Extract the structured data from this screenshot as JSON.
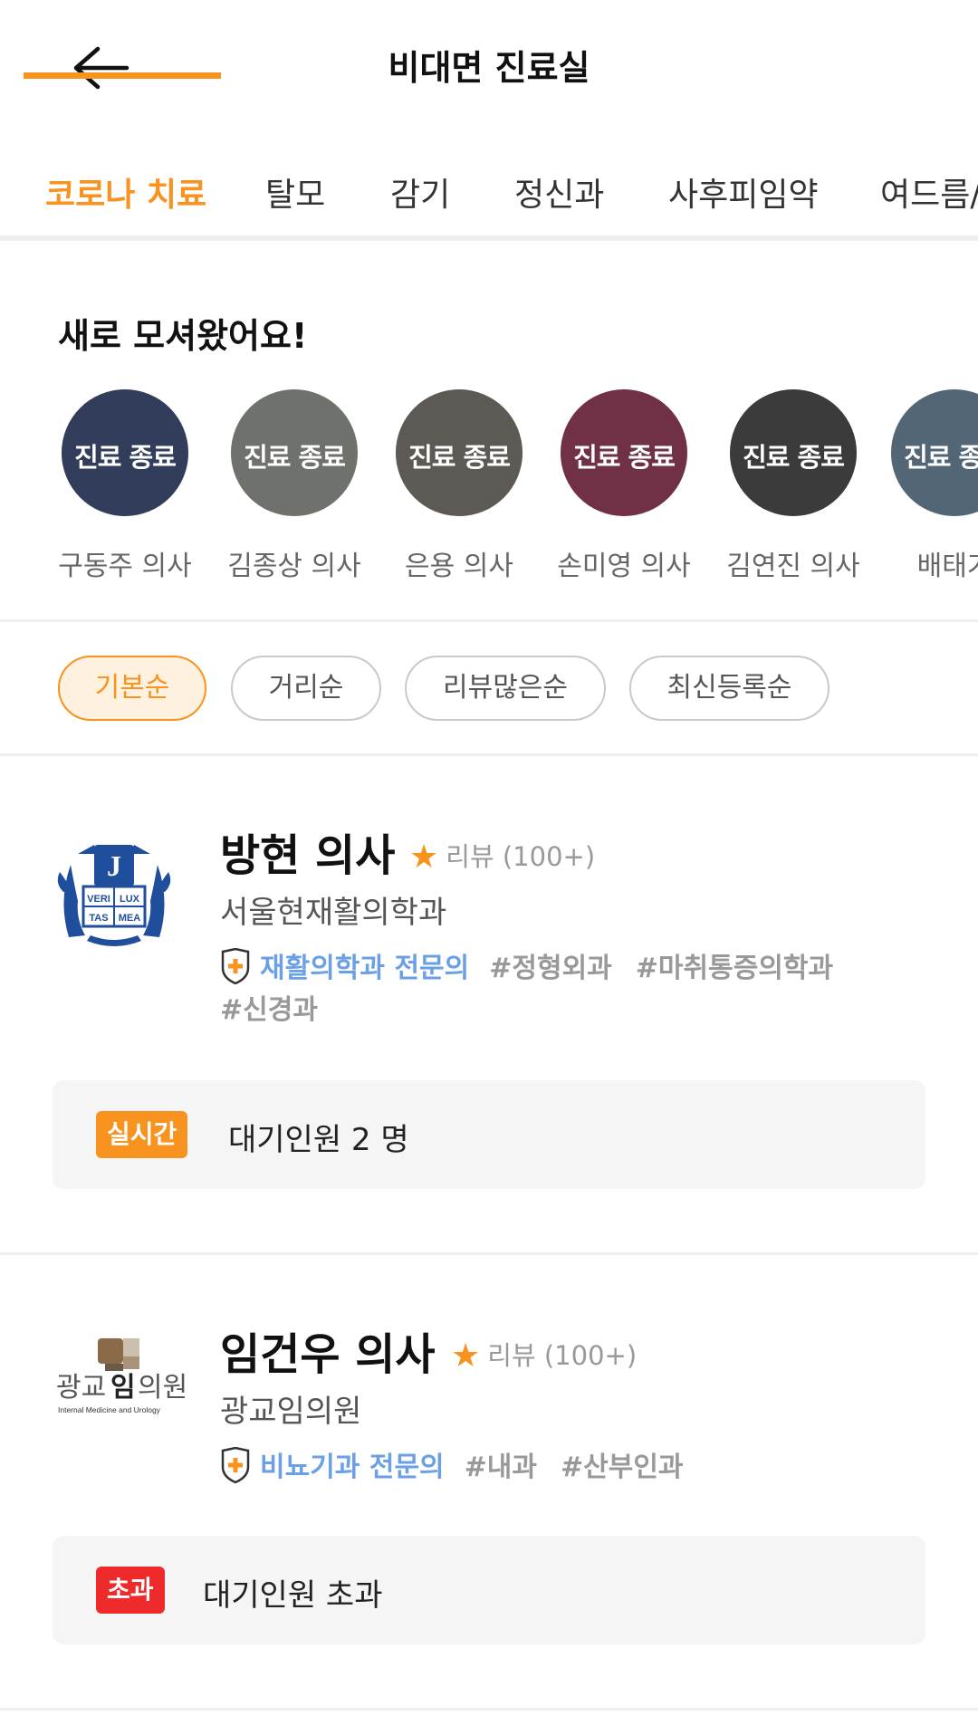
{
  "header": {
    "title": "비대면 진료실"
  },
  "tabs": [
    {
      "label": "코로나 치료"
    },
    {
      "label": "탈모"
    },
    {
      "label": "감기"
    },
    {
      "label": "정신과"
    },
    {
      "label": "사후피임약"
    },
    {
      "label": "여드름/"
    }
  ],
  "new_doctors": {
    "title": "새로 모셔왔어요!",
    "ended_label": "진료 종료",
    "items": [
      {
        "name": "구동주 의사",
        "color": "#2c3e6b"
      },
      {
        "name": "김종상 의사",
        "color": "#8a8f86"
      },
      {
        "name": "은용 의사",
        "color": "#6f6a63"
      },
      {
        "name": "손미영 의사",
        "color": "#8c2a4a"
      },
      {
        "name": "김연진 의사",
        "color": "#3b3b3b"
      },
      {
        "name": "배태기",
        "color": "#5f7d96"
      }
    ]
  },
  "sort_options": [
    {
      "label": "기본순",
      "active": true
    },
    {
      "label": "거리순",
      "active": false
    },
    {
      "label": "리뷰많은순",
      "active": false
    },
    {
      "label": "최신등록순",
      "active": false
    }
  ],
  "doctors": [
    {
      "name": "방현 의사",
      "rating_label": "리뷰 (100+)",
      "clinic": "서울현재활의학과",
      "specialty": "재활의학과 전문의",
      "tags": [
        "#정형외과",
        "#마취통증의학과",
        "#신경과"
      ],
      "wait_badge": "실시간",
      "wait_badge_color": "#f7931e",
      "wait_text": "대기인원 2 명"
    },
    {
      "name": "임건우 의사",
      "rating_label": "리뷰 (100+)",
      "clinic": "광교임의원",
      "specialty": "비뇨기과 전문의",
      "tags": [
        "#내과",
        "#산부인과"
      ],
      "wait_badge": "초과",
      "wait_badge_color": "#ee2a2a",
      "wait_text": "대기인원 초과"
    }
  ],
  "logos": {
    "first": {
      "text_1": "VERI",
      "text_2": "LUX",
      "text_3": "TAS",
      "text_4": "MEA"
    },
    "second": {
      "main_1": "광교",
      "main_2": "임",
      "main_3": "의원",
      "sub": "Internal Medicine and Urology"
    }
  },
  "theme": {
    "accent": "#f7931e",
    "spec_blue": "#6b9fe6"
  }
}
